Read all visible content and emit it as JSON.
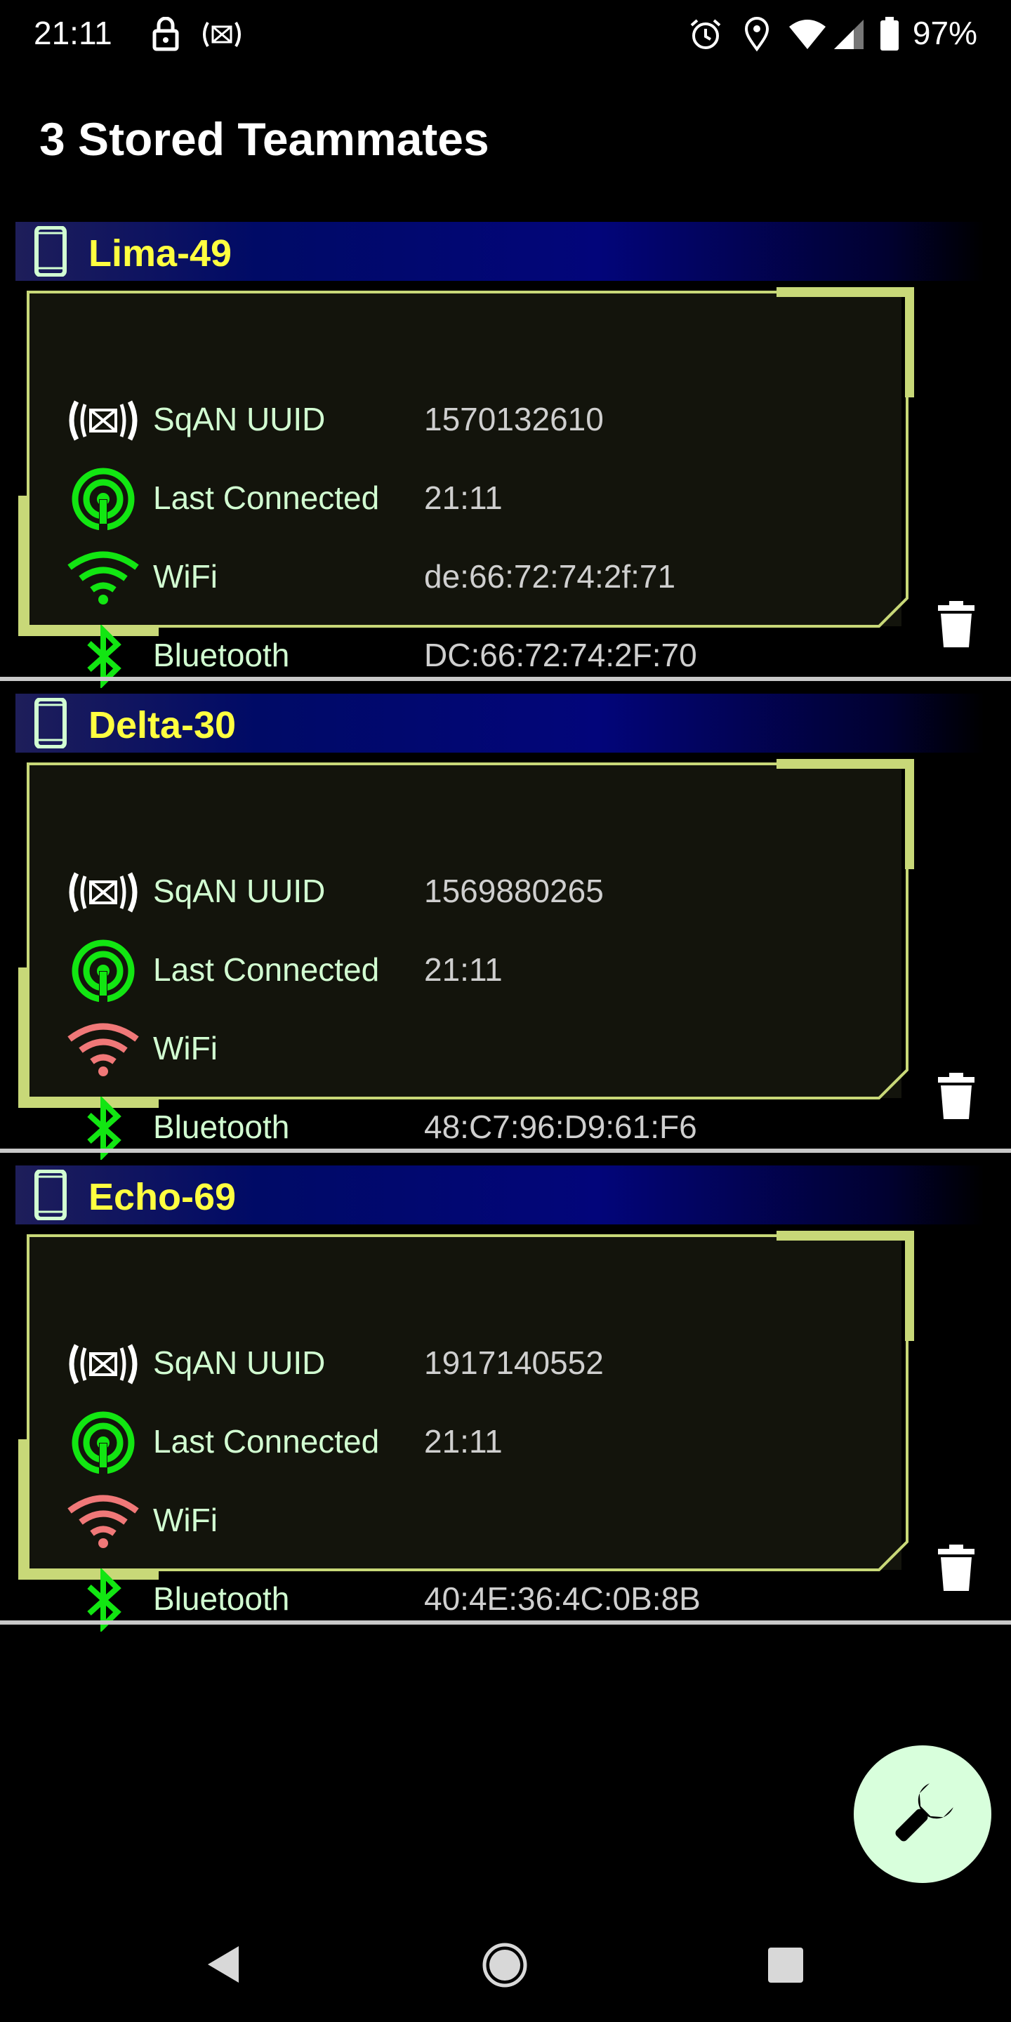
{
  "status_bar": {
    "time": "21:11",
    "battery_text": "97%",
    "icons": [
      "lock-icon",
      "sqan-icon",
      "alarm-icon",
      "location-icon",
      "wifi-icon",
      "signal-icon",
      "battery-icon"
    ]
  },
  "title": "3 Stored Teammates",
  "colors": {
    "header_text": "#ffff40",
    "frame": "#c8d878",
    "icon_green": "#12e612",
    "wifi_off": "#f07878",
    "fab_bg": "#d8ffdc"
  },
  "teammates": [
    {
      "name": "Lima-49",
      "rows": [
        {
          "icon": "sqan-uuid-icon",
          "label": "SqAN UUID",
          "value": "1570132610"
        },
        {
          "icon": "last-connected-icon",
          "label": "Last Connected",
          "value": "21:11"
        },
        {
          "icon": "wifi-icon",
          "label": "WiFi",
          "value": "de:66:72:74:2f:71",
          "wifi_state": "on"
        },
        {
          "icon": "bluetooth-icon",
          "label": "Bluetooth",
          "value": "DC:66:72:74:2F:70"
        }
      ]
    },
    {
      "name": "Delta-30",
      "rows": [
        {
          "icon": "sqan-uuid-icon",
          "label": "SqAN UUID",
          "value": "1569880265"
        },
        {
          "icon": "last-connected-icon",
          "label": "Last Connected",
          "value": "21:11"
        },
        {
          "icon": "wifi-icon",
          "label": "WiFi",
          "value": "",
          "wifi_state": "off"
        },
        {
          "icon": "bluetooth-icon",
          "label": "Bluetooth",
          "value": "48:C7:96:D9:61:F6"
        }
      ]
    },
    {
      "name": "Echo-69",
      "rows": [
        {
          "icon": "sqan-uuid-icon",
          "label": "SqAN UUID",
          "value": "1917140552"
        },
        {
          "icon": "last-connected-icon",
          "label": "Last Connected",
          "value": "21:11"
        },
        {
          "icon": "wifi-icon",
          "label": "WiFi",
          "value": "",
          "wifi_state": "off"
        },
        {
          "icon": "bluetooth-icon",
          "label": "Bluetooth",
          "value": "40:4E:36:4C:0B:8B"
        }
      ]
    }
  ],
  "fab": {
    "icon": "wrench-icon"
  },
  "nav": [
    "back-icon",
    "home-icon",
    "recents-icon"
  ]
}
